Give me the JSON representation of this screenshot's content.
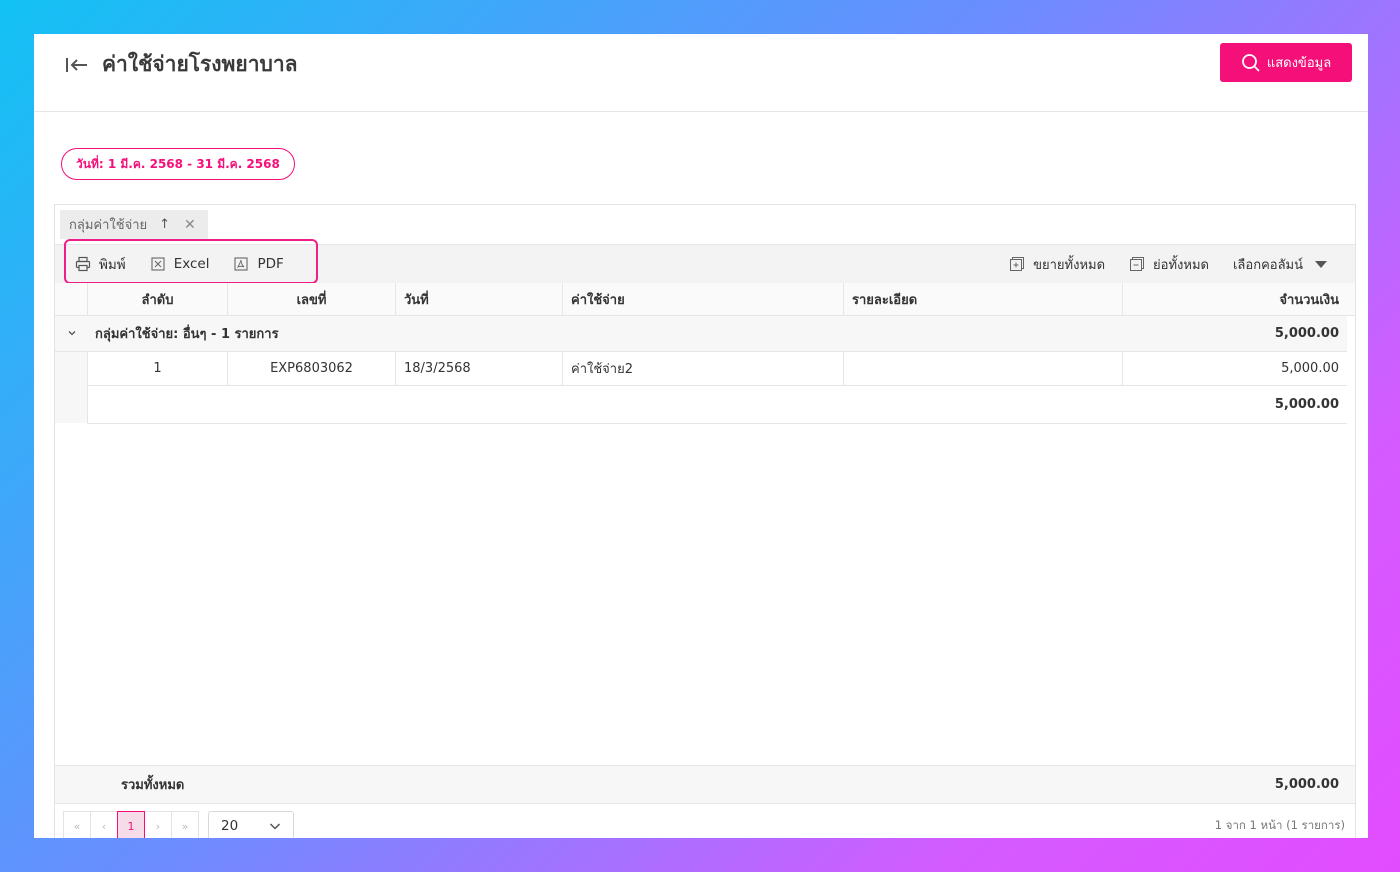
{
  "header": {
    "title": "ค่าใช้จ่ายโรงพยาบาล",
    "show_button": "แสดงข้อมูล"
  },
  "filter": {
    "date_range": "วันที่: 1 มี.ค. 2568 - 31 มี.ค. 2568"
  },
  "group_panel": {
    "chip_label": "กลุ่มค่าใช้จ่าย",
    "arrow": "↑",
    "remove": "✕"
  },
  "toolbar": {
    "print": "พิมพ์",
    "excel": "Excel",
    "pdf": "PDF",
    "expand_all": "ขยายทั้งหมด",
    "collapse_all": "ย่อทั้งหมด",
    "choose_columns": "เลือกคอลัมน์"
  },
  "columns": {
    "order": "ลำดับ",
    "number": "เลขที่",
    "date": "วันที่",
    "expense": "ค่าใช้จ่าย",
    "detail": "รายละเอียด",
    "amount": "จำนวนเงิน"
  },
  "group_row": {
    "label": "กลุ่มค่าใช้จ่าย: อื่นๆ - 1 รายการ",
    "amount": "5,000.00"
  },
  "rows": [
    {
      "order": "1",
      "number": "EXP6803062",
      "date": "18/3/2568",
      "expense": "ค่าใช้จ่าย2",
      "detail": "",
      "amount": "5,000.00"
    }
  ],
  "group_subtotal": "5,000.00",
  "total": {
    "label": "รวมทั้งหมด",
    "amount": "5,000.00"
  },
  "pager": {
    "first": "«",
    "prev": "‹",
    "current": "1",
    "next": "›",
    "last": "»",
    "page_size": "20",
    "info": "1 จาก 1 หน้า (1 รายการ)"
  },
  "colors": {
    "accent": "#f50f79",
    "highlight": "#ef1f8a"
  }
}
